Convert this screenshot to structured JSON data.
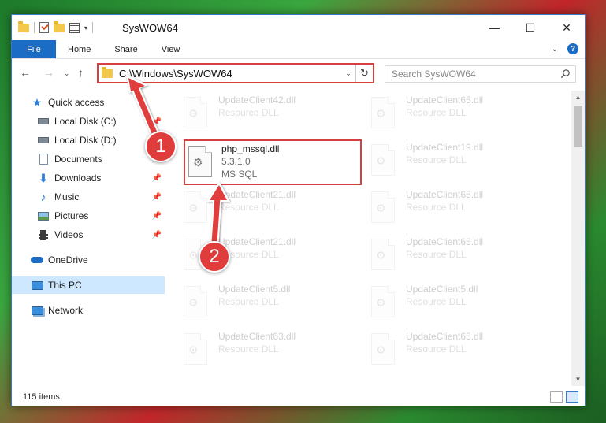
{
  "window": {
    "title": "SysWOW64",
    "minimize": "—",
    "maximize": "☐",
    "close": "✕"
  },
  "ribbon": {
    "tabs": [
      "File",
      "Home",
      "Share",
      "View"
    ]
  },
  "nav": {
    "address": "C:\\Windows\\SysWOW64",
    "search_placeholder": "Search SysWOW64"
  },
  "sidebar": {
    "items": [
      {
        "label": "Quick access",
        "icon": "star-icon",
        "pinned": false
      },
      {
        "label": "Local Disk (C:)",
        "icon": "drive-icon",
        "pinned": true
      },
      {
        "label": "Local Disk (D:)",
        "icon": "drive-icon",
        "pinned": false
      },
      {
        "label": "Documents",
        "icon": "documents-icon",
        "pinned": true
      },
      {
        "label": "Downloads",
        "icon": "download-icon",
        "pinned": true
      },
      {
        "label": "Music",
        "icon": "music-icon",
        "pinned": true
      },
      {
        "label": "Pictures",
        "icon": "pictures-icon",
        "pinned": true
      },
      {
        "label": "Videos",
        "icon": "videos-icon",
        "pinned": true
      },
      {
        "label": "OneDrive",
        "icon": "cloud-icon",
        "pinned": false
      },
      {
        "label": "This PC",
        "icon": "computer-icon",
        "pinned": false
      },
      {
        "label": "Network",
        "icon": "network-icon",
        "pinned": false
      }
    ]
  },
  "files": {
    "highlighted": {
      "name": "php_mssql.dll",
      "version": "5.3.1.0",
      "description": "MS SQL"
    },
    "left_column": [
      {
        "name": "UpdateClient42.dll",
        "type": "Resource DLL"
      },
      {
        "name": "UpdateClient21.dll",
        "type": "Resource DLL"
      },
      {
        "name": "UpdateClient21.dll",
        "type": "Resource DLL"
      },
      {
        "name": "UpdateClient5.dll",
        "type": "Resource DLL"
      },
      {
        "name": "UpdateClient63.dll",
        "type": "Resource DLL"
      }
    ],
    "right_column": [
      {
        "name": "UpdateClient65.dll",
        "type": "Resource DLL"
      },
      {
        "name": "UpdateClient19.dll",
        "type": "Resource DLL"
      },
      {
        "name": "UpdateClient65.dll",
        "type": "Resource DLL"
      },
      {
        "name": "UpdateClient65.dll",
        "type": "Resource DLL"
      },
      {
        "name": "UpdateClient5.dll",
        "type": "Resource DLL"
      },
      {
        "name": "UpdateClient65.dll",
        "type": "Resource DLL"
      }
    ]
  },
  "status": {
    "item_count": "115 items"
  },
  "annotations": {
    "step1": "1",
    "step2": "2",
    "color": "#e03c3c"
  }
}
